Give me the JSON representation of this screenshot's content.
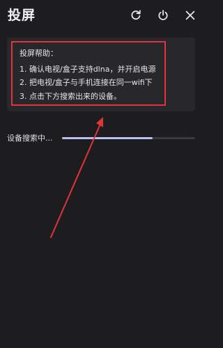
{
  "header": {
    "title": "投屏",
    "icons": [
      "refresh-icon",
      "power-icon",
      "close-icon"
    ]
  },
  "help": {
    "heading": "投屏帮助：",
    "steps": [
      "1. 确认电视/盒子支持dlna，并开启电源",
      "2. 把电视/盒子与手机连接在同一wifi下",
      "3. 点击下方搜索出来的设备。"
    ]
  },
  "search": {
    "label": "设备搜索中...",
    "progress": 0.68
  },
  "colors": {
    "background": "#1d1d20",
    "card": "#28282c",
    "highlight_box": "#e0343c",
    "arrow": "#e0343c",
    "progress_fill": "#b9c2ee",
    "progress_track": "#3a3a3f"
  }
}
